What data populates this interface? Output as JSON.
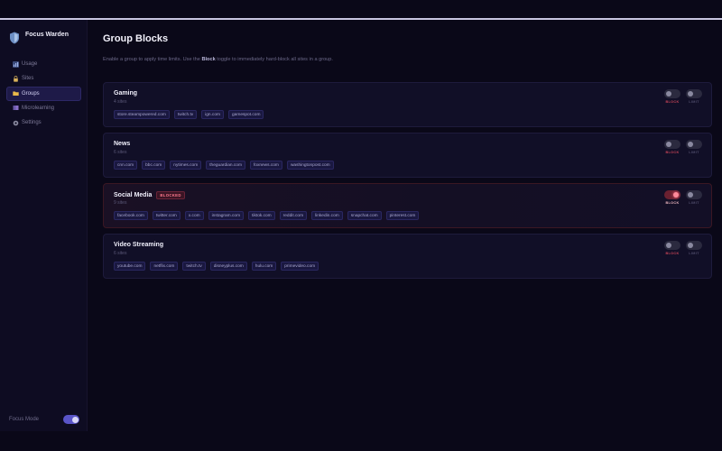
{
  "app": {
    "name": "Focus Warden",
    "version": ""
  },
  "sidebar": {
    "items": [
      {
        "label": "Usage",
        "icon": "chart-icon",
        "active": false
      },
      {
        "label": "Sites",
        "icon": "lock-icon",
        "active": false
      },
      {
        "label": "Groups",
        "icon": "folder-icon",
        "active": true
      },
      {
        "label": "Microlearning",
        "icon": "book-icon",
        "active": false
      },
      {
        "label": "Settings",
        "icon": "gear-icon",
        "active": false
      }
    ],
    "focus_mode": {
      "label": "Focus Mode",
      "enabled": true
    }
  },
  "page": {
    "title": "Group Blocks",
    "desc_before": "Enable a group to apply time limits. Use the ",
    "desc_bold": "Block",
    "desc_after": " toggle to immediately hard-block all sites in a group."
  },
  "toggle_labels": {
    "block": "BLOCK",
    "limit": "LIMIT"
  },
  "groups": [
    {
      "name": "Gaming",
      "count": "4 sites",
      "blocked": false,
      "badge": "",
      "sites": [
        "store.steampowered.com",
        "twitch.tv",
        "ign.com",
        "gamespot.com"
      ]
    },
    {
      "name": "News",
      "count": "6 sites",
      "blocked": false,
      "badge": "",
      "sites": [
        "cnn.com",
        "bbc.com",
        "nytimes.com",
        "theguardian.com",
        "foxnews.com",
        "washingtonpost.com"
      ]
    },
    {
      "name": "Social Media",
      "count": "9 sites",
      "blocked": true,
      "badge": "BLOCKED",
      "sites": [
        "facebook.com",
        "twitter.com",
        "x.com",
        "instagram.com",
        "tiktok.com",
        "reddit.com",
        "linkedin.com",
        "snapchat.com",
        "pinterest.com"
      ]
    },
    {
      "name": "Video Streaming",
      "count": "6 sites",
      "blocked": false,
      "badge": "",
      "sites": [
        "youtube.com",
        "netflix.com",
        "twitch.tv",
        "disneyplus.com",
        "hulu.com",
        "primevideo.com"
      ]
    }
  ],
  "colors": {
    "accent": "#5a55c8",
    "block_red": "#c84458",
    "background": "#0a0818"
  }
}
